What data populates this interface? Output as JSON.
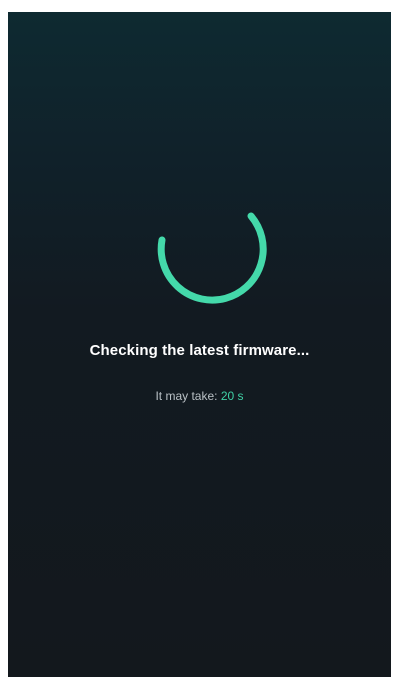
{
  "loading": {
    "title": "Checking the latest firmware...",
    "eta_label": "It may take:",
    "eta_value": "20 s"
  },
  "colors": {
    "accent": "#44d9aa",
    "background_top": "#0e2a31",
    "background_bottom": "#13181d",
    "title_text": "#ffffff",
    "secondary_text": "#b9c1c5"
  },
  "icons": {
    "spinner": "loading-spinner-arc"
  }
}
